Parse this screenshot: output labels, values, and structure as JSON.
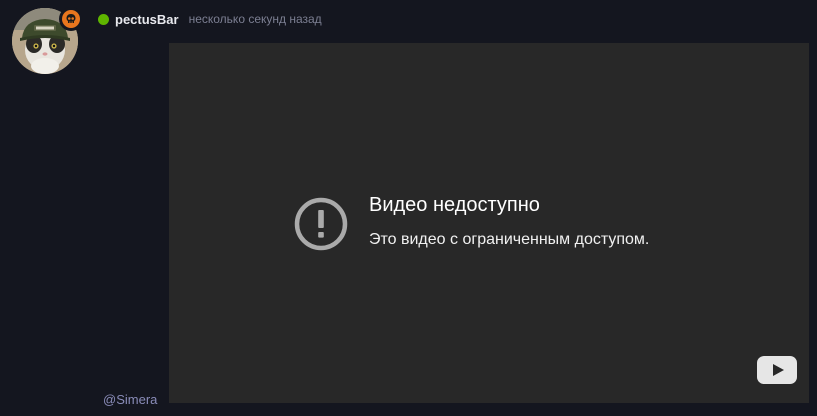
{
  "message": {
    "username": "pectusBar",
    "timestamp": "несколько секунд назад",
    "status_color": "#5fb500",
    "badge_color": "#e8761e"
  },
  "video": {
    "error_title": "Видео недоступно",
    "error_subtitle": "Это видео с ограниченным доступом.",
    "logo": "youtube-play-icon"
  },
  "mention": "@Simera"
}
